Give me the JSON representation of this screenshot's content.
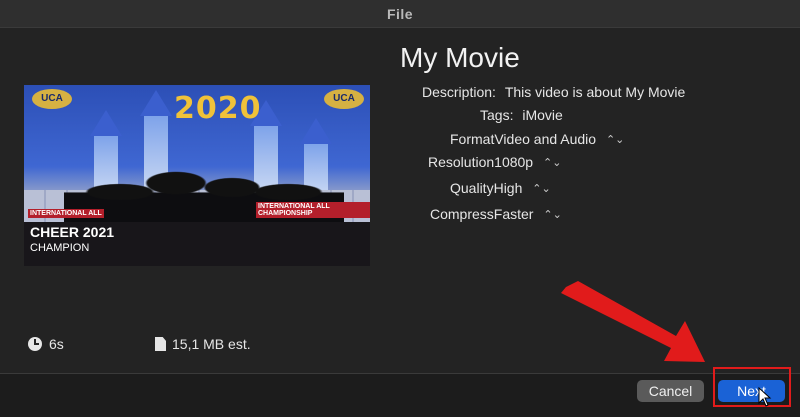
{
  "window": {
    "title": "File"
  },
  "movie": {
    "title": "My Movie",
    "thumbnail": {
      "year_banner": "2020",
      "logo_left": "UCA",
      "logo_right": "UCA",
      "caption_line1": "CHEER 2021",
      "caption_line2": "CHAMPION",
      "side_left": "INTERNATIONAL ALL",
      "side_right": "INTERNATIONAL ALL CHAMPIONSHIP"
    }
  },
  "fields": {
    "description": {
      "label": "Description:",
      "value": "This video is about My Movie"
    },
    "tags": {
      "label": "Tags:",
      "value": "iMovie"
    },
    "format": {
      "label": "Format",
      "value": "Video and Audio"
    },
    "resolution": {
      "label": "Resolution",
      "value": "1080p"
    },
    "quality": {
      "label": "Quality",
      "value": "High"
    },
    "compress": {
      "label": "Compress",
      "value": "Faster"
    }
  },
  "info": {
    "duration": "6s",
    "size": "15,1 MB est."
  },
  "buttons": {
    "cancel": "Cancel",
    "next": "Next"
  },
  "icons": {
    "stepper": "up-down-chevron-icon",
    "clock": "clock-icon",
    "file": "file-icon"
  },
  "colors": {
    "accent": "#1a62d6",
    "annotation": "#e11b1b"
  }
}
